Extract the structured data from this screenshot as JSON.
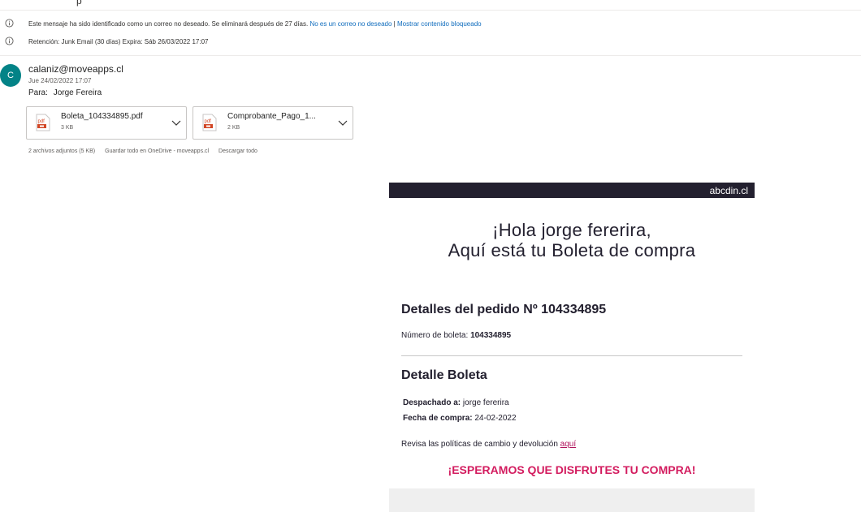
{
  "top_fragment": "p",
  "notices": [
    {
      "icon": "info-icon",
      "text": "Este mensaje ha sido identificado como un correo no deseado. Se eliminará después de 27 días.",
      "link1": "No es un correo no deseado",
      "divider": "|",
      "link2": "Mostrar contenido bloqueado"
    },
    {
      "icon": "info-icon",
      "text": "Retención: Junk Email (30 días) Expira: Sáb 26/03/2022 17:07"
    }
  ],
  "message": {
    "avatar_initial": "C",
    "sender": "calaniz@moveapps.cl",
    "date": "Jue 24/02/2022 17:07",
    "to_label": "Para:",
    "to_name": "Jorge Fereira",
    "attachments": [
      {
        "name": "Boleta_104334895.pdf",
        "size": "3 KB",
        "icon": "pdf-icon"
      },
      {
        "name": "Comprobante_Pago_1...",
        "size": "2 KB",
        "icon": "pdf-icon"
      }
    ],
    "attachment_actions": {
      "summary": "2 archivos adjuntos (5 KB)",
      "save": "Guardar todo en OneDrive - moveapps.cl",
      "download": "Descargar todo"
    }
  },
  "email_body": {
    "brand": "abcdin.cl",
    "greeting_line1": "¡Hola jorge fererira,",
    "greeting_line2": "Aquí está tu Boleta de compra",
    "order_heading": "Detalles del pedido Nº 104334895",
    "boleta_label": "Número de boleta:",
    "boleta_value": "104334895",
    "detail_heading": "Detalle Boleta",
    "dispatched_label": "Despachado a:",
    "dispatched_value": "jorge fererira",
    "date_label": "Fecha de compra:",
    "date_value": "24-02-2022",
    "policy_text": "Revisa las políticas de cambio y devolución",
    "policy_link": "aquí",
    "slogan": "¡ESPERAMOS QUE DISFRUTES TU COMPRA!",
    "colors": {
      "header_bar": "#23202f",
      "slogan": "#d31c5f",
      "link": "#b0125b"
    }
  }
}
